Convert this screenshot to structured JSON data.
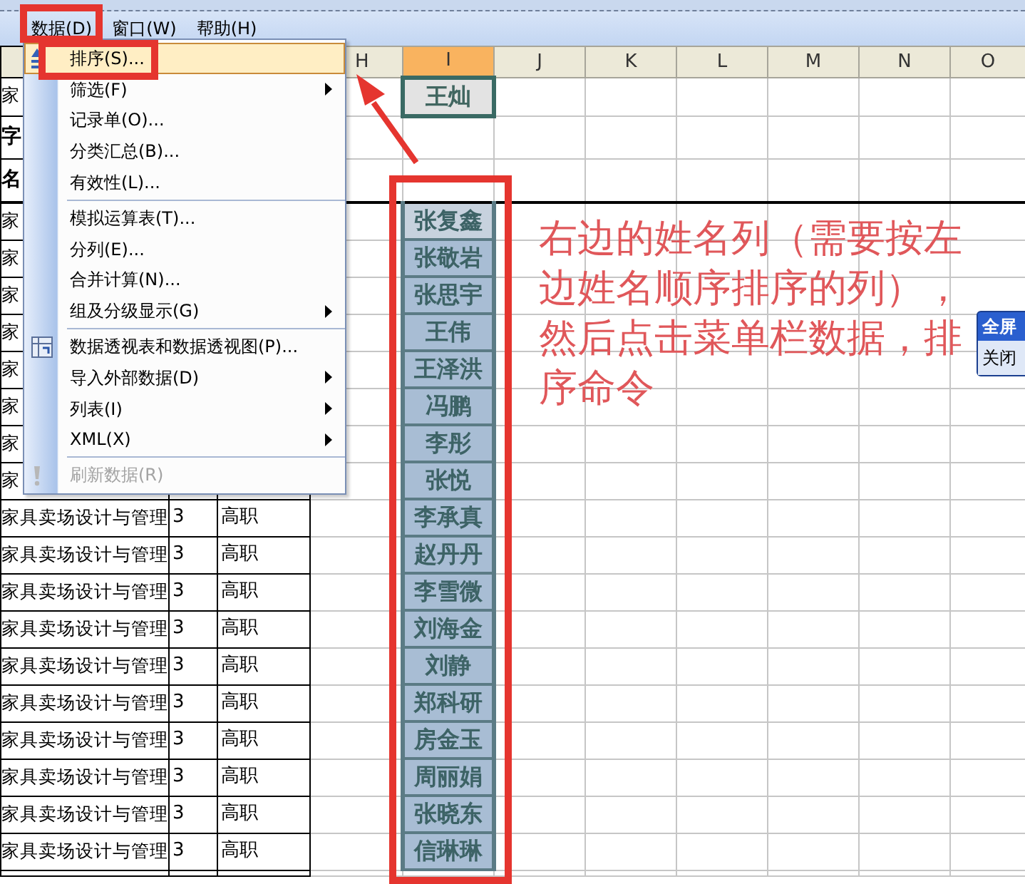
{
  "menubar": [
    "数据(D)",
    "窗口(W)",
    "帮助(H)"
  ],
  "menu": {
    "groups": [
      [
        {
          "label": "排序(S)...",
          "selected": true,
          "disabled": false,
          "submenu": false
        },
        {
          "label": "筛选(F)",
          "selected": false,
          "disabled": false,
          "submenu": true
        },
        {
          "label": "记录单(O)...",
          "selected": false,
          "disabled": false,
          "submenu": false
        },
        {
          "label": "分类汇总(B)...",
          "selected": false,
          "disabled": false,
          "submenu": false
        },
        {
          "label": "有效性(L)...",
          "selected": false,
          "disabled": false,
          "submenu": false
        }
      ],
      [
        {
          "label": "模拟运算表(T)...",
          "selected": false,
          "disabled": false,
          "submenu": false
        },
        {
          "label": "分列(E)...",
          "selected": false,
          "disabled": false,
          "submenu": false
        },
        {
          "label": "合并计算(N)...",
          "selected": false,
          "disabled": false,
          "submenu": false
        },
        {
          "label": "组及分级显示(G)",
          "selected": false,
          "disabled": false,
          "submenu": true
        }
      ],
      [
        {
          "label": "数据透视表和数据透视图(P)...",
          "selected": false,
          "disabled": false,
          "submenu": false
        },
        {
          "label": "导入外部数据(D)",
          "selected": false,
          "disabled": false,
          "submenu": true
        },
        {
          "label": "列表(I)",
          "selected": false,
          "disabled": false,
          "submenu": true
        },
        {
          "label": "XML(X)",
          "selected": false,
          "disabled": false,
          "submenu": true
        }
      ],
      [
        {
          "label": "刷新数据(R)",
          "selected": false,
          "disabled": true,
          "submenu": false
        }
      ]
    ]
  },
  "columns": [
    {
      "label": "H",
      "selected": false
    },
    {
      "label": "I",
      "selected": true
    },
    {
      "label": "J",
      "selected": false
    },
    {
      "label": "K",
      "selected": false
    },
    {
      "label": "L",
      "selected": false
    },
    {
      "label": "M",
      "selected": false
    },
    {
      "label": "N",
      "selected": false
    },
    {
      "label": "O",
      "selected": false
    }
  ],
  "rows": [
    {
      "kind": "data",
      "column_1": "家",
      "name": {
        "text": "王灿",
        "kind": "active"
      }
    },
    {
      "kind": "title",
      "column_1": "字"
    },
    {
      "kind": "title",
      "column_1": "名"
    },
    {
      "kind": "data",
      "column_1": "家",
      "name": {
        "text": "张复鑫",
        "kind": "highlighted"
      }
    },
    {
      "kind": "data",
      "column_1": "家",
      "name": {
        "text": "张敬岩",
        "kind": "plain"
      }
    },
    {
      "kind": "data",
      "column_1": "家",
      "name": {
        "text": "张思宇",
        "kind": "plain"
      }
    },
    {
      "kind": "data",
      "column_1": "家",
      "name": {
        "text": "王伟",
        "kind": "plain"
      }
    },
    {
      "kind": "data",
      "column_1": "家",
      "name": {
        "text": "王泽洪",
        "kind": "plain"
      }
    },
    {
      "kind": "data",
      "column_1": "家",
      "name": {
        "text": "冯鹏",
        "kind": "plain"
      }
    },
    {
      "kind": "data",
      "column_1": "家",
      "name": {
        "text": "李彤",
        "kind": "plain"
      }
    },
    {
      "kind": "data",
      "column_1": "家",
      "name": {
        "text": "张悦",
        "kind": "plain"
      }
    },
    {
      "kind": "data",
      "column_1": "家具卖场设计与管理",
      "column_2": "3",
      "column_3": "高职",
      "name": {
        "text": "李承真",
        "kind": "plain"
      }
    },
    {
      "kind": "data",
      "column_1": "家具卖场设计与管理",
      "column_2": "3",
      "column_3": "高职",
      "name": {
        "text": "赵丹丹",
        "kind": "plain"
      }
    },
    {
      "kind": "data",
      "column_1": "家具卖场设计与管理",
      "column_2": "3",
      "column_3": "高职",
      "name": {
        "text": "李雪微",
        "kind": "plain"
      }
    },
    {
      "kind": "data",
      "column_1": "家具卖场设计与管理",
      "column_2": "3",
      "column_3": "高职",
      "name": {
        "text": "刘海金",
        "kind": "plain"
      }
    },
    {
      "kind": "data",
      "column_1": "家具卖场设计与管理",
      "column_2": "3",
      "column_3": "高职",
      "name": {
        "text": "刘静",
        "kind": "plain"
      }
    },
    {
      "kind": "data",
      "column_1": "家具卖场设计与管理",
      "column_2": "3",
      "column_3": "高职",
      "name": {
        "text": "郑科研",
        "kind": "plain"
      }
    },
    {
      "kind": "data",
      "column_1": "家具卖场设计与管理",
      "column_2": "3",
      "column_3": "高职",
      "name": {
        "text": "房金玉",
        "kind": "plain"
      }
    },
    {
      "kind": "data",
      "column_1": "家具卖场设计与管理",
      "column_2": "3",
      "column_3": "高职",
      "name": {
        "text": "周丽娟",
        "kind": "plain"
      }
    },
    {
      "kind": "data",
      "column_1": "家具卖场设计与管理",
      "column_2": "3",
      "column_3": "高职",
      "name": {
        "text": "张晓东",
        "kind": "plain"
      }
    },
    {
      "kind": "data",
      "column_1": "家具卖场设计与管理",
      "column_2": "3",
      "column_3": "高职",
      "name": {
        "text": "信琳琳",
        "kind": "plain"
      }
    }
  ],
  "annotation": {
    "text": "右边的姓名列（需要按左边姓名顺序排序的列），然后点击菜单栏数据，排序命令"
  },
  "floating_toolbar": {
    "title": "全屏",
    "button": "关闭"
  }
}
